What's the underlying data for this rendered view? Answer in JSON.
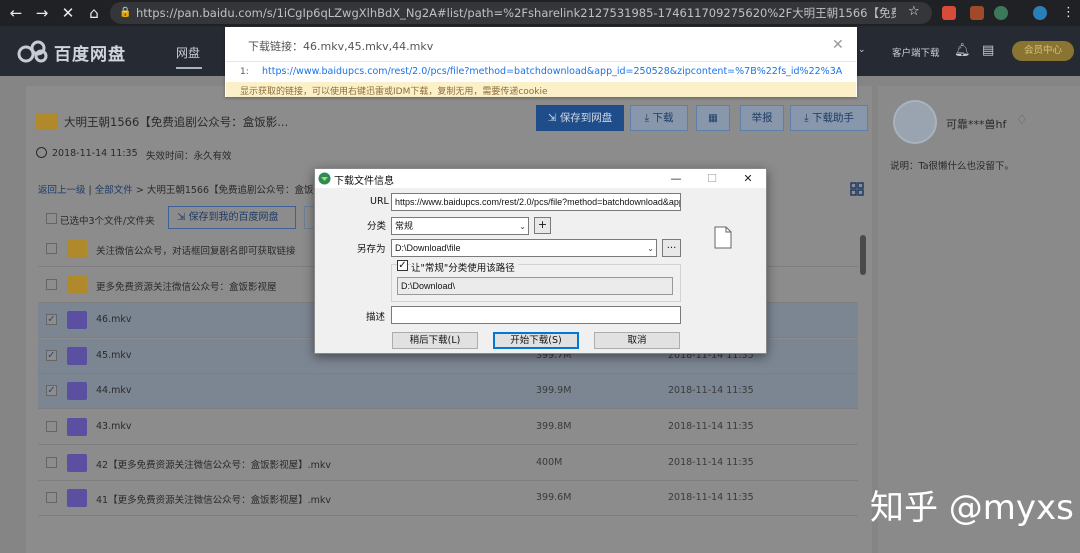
{
  "browser": {
    "url": "https://pan.baidu.com/s/1iCgIp6qLZwgXlhBdX_Ng2A#list/path=%2Fsharelink2127531985-174611709275620%2F大明王朝1566【免费追剧公众..."
  },
  "topnav": {
    "logo": "百度网盘",
    "active_tab": "网盘",
    "client_download": "客户端下载",
    "vip": "会员中心"
  },
  "share": {
    "title": "大明王朝1566【免费追剧公众号：盒饭影...",
    "date": "2018-11-14 11:35",
    "expire": "失效时间：永久有效",
    "buttons": {
      "save_cloud": "保存到网盘",
      "download": "下载",
      "report": "举报",
      "download_helper": "下载助手"
    },
    "breadcrumb": {
      "back": "返回上一级",
      "all": "全部文件",
      "current": "大明王朝1566【免费追剧公众号：盒饭"
    },
    "selected_text": "已选中3个文件/文件夹",
    "save_mine": "保存到我的百度网盘"
  },
  "files": [
    {
      "name": "关注微信公众号，对话框回复剧名即可获取链接",
      "type": "folder",
      "checked": false,
      "size": "",
      "date": ""
    },
    {
      "name": "更多免费资源关注微信公众号：盒饭影视屋",
      "type": "folder",
      "checked": false,
      "size": "",
      "date": ""
    },
    {
      "name": "46.mkv",
      "type": "video",
      "checked": true,
      "size": "",
      "date": ""
    },
    {
      "name": "45.mkv",
      "type": "video",
      "checked": true,
      "size": "399.7M",
      "date": "2018-11-14 11:35"
    },
    {
      "name": "44.mkv",
      "type": "video",
      "checked": true,
      "size": "399.9M",
      "date": "2018-11-14 11:35"
    },
    {
      "name": "43.mkv",
      "type": "video",
      "checked": false,
      "size": "399.8M",
      "date": "2018-11-14 11:35"
    },
    {
      "name": "42【更多免费资源关注微信公众号：盒饭影视屋】.mkv",
      "type": "video",
      "checked": false,
      "size": "400M",
      "date": "2018-11-14 11:35"
    },
    {
      "name": "41【更多免费资源关注微信公众号：盒饭影视屋】.mkv",
      "type": "video",
      "checked": false,
      "size": "399.6M",
      "date": "2018-11-14 11:35"
    }
  ],
  "user": {
    "name": "可靠***兽hf",
    "desc": "说明：Ta很懒什么也没留下。"
  },
  "notice": {
    "title": "下载链接：46.mkv,45.mkv,44.mkv",
    "num": "1:",
    "url": "https://www.baidupcs.com/rest/2.0/pcs/file?method=batchdownload&app_id=250528&zipcontent=%7B%22fs_id%22%3A%...",
    "hint": "显示获取的链接，可以使用右键迅雷或IDM下载，复制无用，需要传递cookie"
  },
  "dialog": {
    "title": "下载文件信息",
    "url_label": "URL",
    "url_value": "https://www.baidupcs.com/rest/2.0/pcs/file?method=batchdownload&app_",
    "category_label": "分类",
    "category_value": "常规",
    "add_btn": "+",
    "saveas_label": "另存为",
    "saveas_value": "D:\\Download\\file",
    "browse_btn": "...",
    "checkbox_label": "让\"常规\"分类使用该路径",
    "path_value": "D:\\Download\\",
    "desc_label": "描述",
    "btn_later": "稍后下载(L)",
    "btn_start": "开始下载(S)",
    "btn_cancel": "取消"
  },
  "watermark": "知乎 @myxs",
  "colors": {
    "chrome_bg": "#202124",
    "brand_blue": "#1f4d8a",
    "link_blue": "#1a73e8",
    "notice_bar": "#fcf0c9"
  }
}
